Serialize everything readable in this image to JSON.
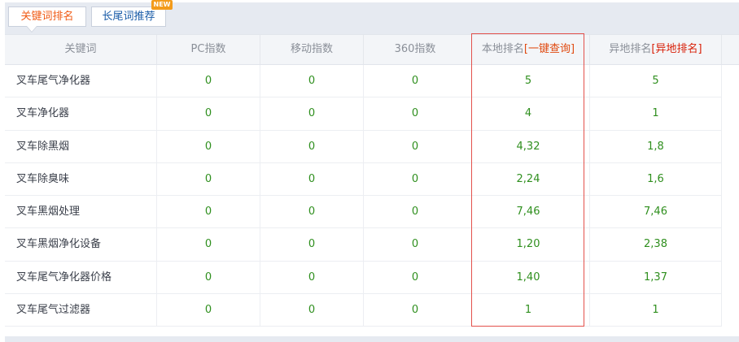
{
  "tabs": [
    {
      "label": "关键词排名",
      "active": true
    },
    {
      "label": "长尾词推荐",
      "active": false,
      "badge": "NEW"
    }
  ],
  "columns": {
    "keyword": "关键词",
    "pc": "PC指数",
    "mobile": "移动指数",
    "s360": "360指数",
    "local": "本地排名",
    "local_link": "[一键查询]",
    "remote": "异地排名",
    "remote_link": "[异地排名]"
  },
  "rows": [
    {
      "keyword": "叉车尾气净化器",
      "pc": "0",
      "mobile": "0",
      "s360": "0",
      "local": "5",
      "remote": "5"
    },
    {
      "keyword": "叉车净化器",
      "pc": "0",
      "mobile": "0",
      "s360": "0",
      "local": "4",
      "remote": "1"
    },
    {
      "keyword": "叉车除黑烟",
      "pc": "0",
      "mobile": "0",
      "s360": "0",
      "local": "4,32",
      "remote": "1,8"
    },
    {
      "keyword": "叉车除臭味",
      "pc": "0",
      "mobile": "0",
      "s360": "0",
      "local": "2,24",
      "remote": "1,6"
    },
    {
      "keyword": "叉车黑烟处理",
      "pc": "0",
      "mobile": "0",
      "s360": "0",
      "local": "7,46",
      "remote": "7,46"
    },
    {
      "keyword": "叉车黑烟净化设备",
      "pc": "0",
      "mobile": "0",
      "s360": "0",
      "local": "1,20",
      "remote": "2,38"
    },
    {
      "keyword": "叉车尾气净化器价格",
      "pc": "0",
      "mobile": "0",
      "s360": "0",
      "local": "1,40",
      "remote": "1,37"
    },
    {
      "keyword": "叉车尾气过滤器",
      "pc": "0",
      "mobile": "0",
      "s360": "0",
      "local": "1",
      "remote": "1"
    }
  ],
  "colors": {
    "accent": "#f05a14",
    "link": "#1a5ca8",
    "number": "#2f8f1e",
    "highlight_border": "#e3514c"
  }
}
